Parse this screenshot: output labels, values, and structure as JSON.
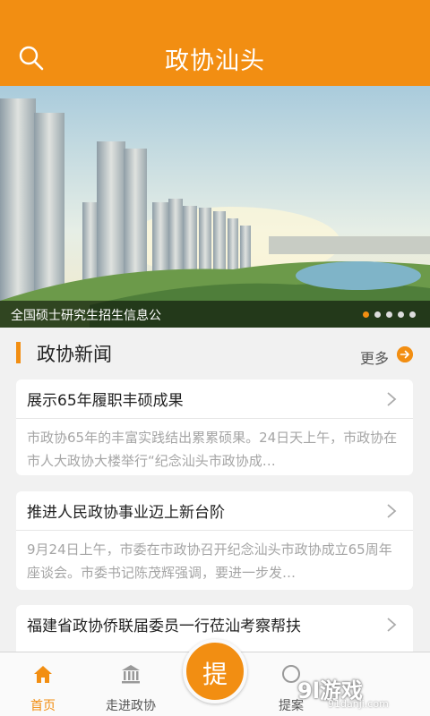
{
  "header": {
    "title": "政协汕头"
  },
  "banner": {
    "caption": "全国硕士研究生招生信息公",
    "slide_count": 5,
    "active_slide": 1
  },
  "section": {
    "title": "政协新闻",
    "more_label": "更多"
  },
  "news": [
    {
      "title": "展示65年履职丰硕成果",
      "summary": "市政协65年的丰富实践结出累累硕果。24日天上午，市政协在市人大政协大楼举行“纪念汕头市政协成…"
    },
    {
      "title": "推进人民政协事业迈上新台阶",
      "summary": "9月24日上午，市委在市政协召开纪念汕头市政协成立65周年座谈会。市委书记陈茂辉强调，要进一步发…"
    },
    {
      "title": "福建省政协侨联届委员一行莅汕考察帮扶"
    }
  ],
  "tabbar": {
    "home_label": "首页",
    "about_label": "走进政协",
    "fab_label": "提",
    "proposal_label": "提案"
  },
  "watermark": {
    "logo": "9l游戏",
    "url": "91danji.com"
  },
  "colors": {
    "accent": "#f28e12",
    "background": "#f1f1f1"
  }
}
